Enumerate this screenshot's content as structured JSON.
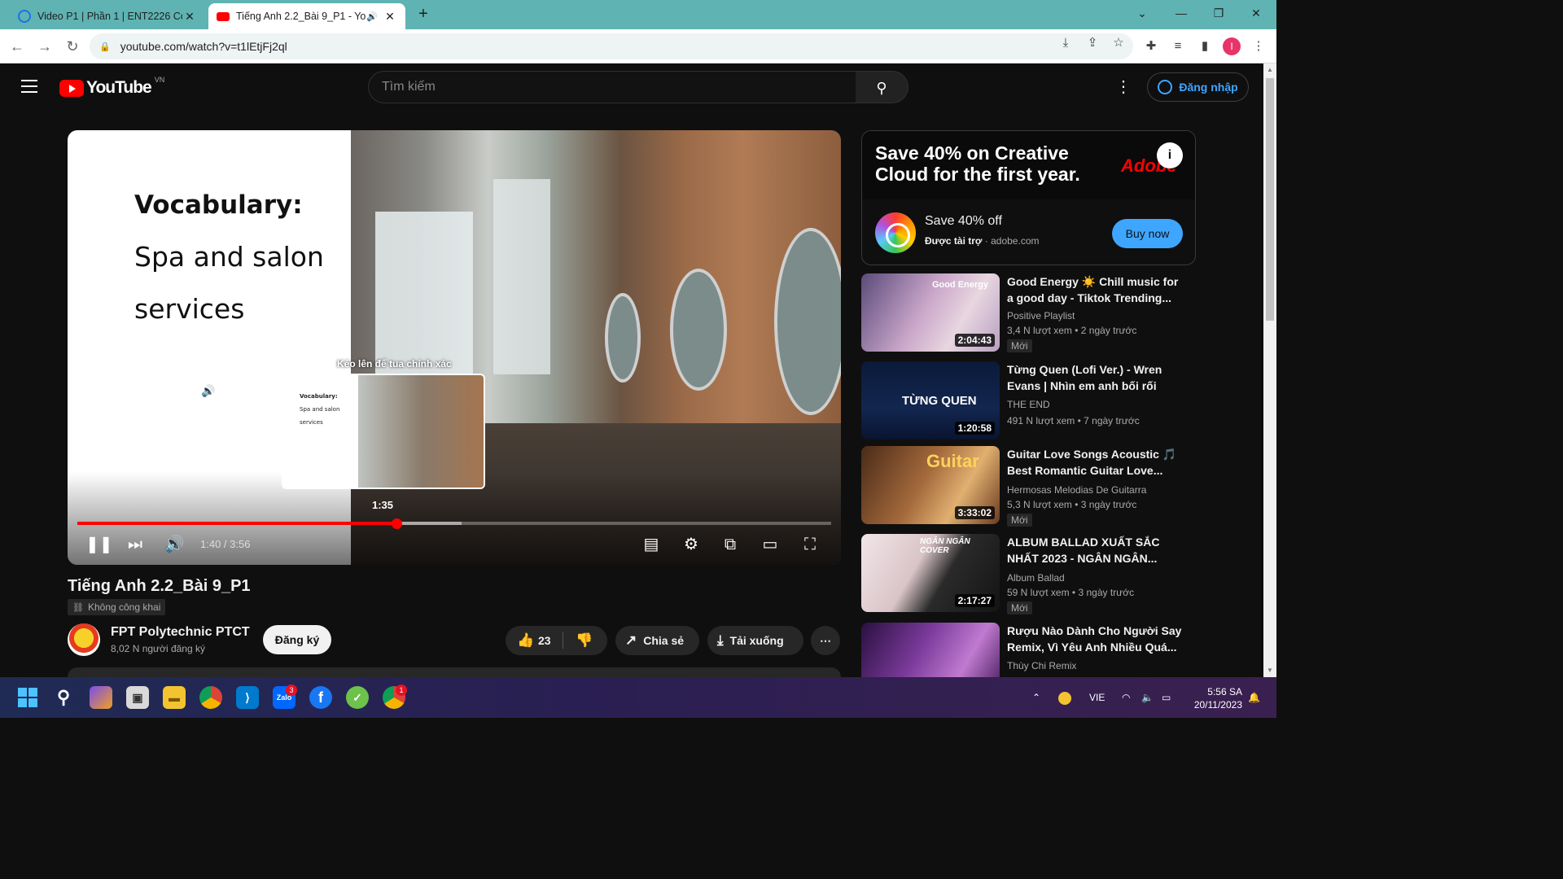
{
  "browser": {
    "tabs": [
      {
        "title": "Video P1 | Phần 1 | ENT2226 Co",
        "active": false
      },
      {
        "title": "Tiếng Anh 2.2_Bài 9_P1 - Yo",
        "active": true
      }
    ],
    "url": "youtube.com/watch?v=t1lEtjFj2ql",
    "profile_initial": "I"
  },
  "youtube": {
    "logo_text": "YouTube",
    "country_code": "VN",
    "search_placeholder": "Tìm kiếm",
    "sign_in_label": "Đăng nhập"
  },
  "player": {
    "slide": {
      "title": "Vocabulary:",
      "line1": "Spa and salon",
      "line2": "services",
      "preview_line1": "Vocabulary:",
      "preview_line2": "Spa and salon",
      "preview_line3": "services"
    },
    "seek_hint": "Kéo lên để tua chính xác",
    "preview_time": "1:35",
    "time_display": "1:40 / 3:56",
    "progress_played_fraction": 0.4237,
    "progress_loaded_fraction": 0.51
  },
  "video": {
    "title": "Tiếng Anh 2.2_Bài 9_P1",
    "visibility": "Không công khai",
    "channel_name": "FPT Polytechnic PTCT",
    "subscribers": "8,02 N người đăng ký",
    "subscribe_label": "Đăng ký",
    "likes": "23",
    "share_label": "Chia sẻ",
    "download_label": "Tải xuống",
    "more_label": "⋯"
  },
  "ad": {
    "headline": "Save 40% on Creative Cloud for the first year.",
    "brand": "Adobe",
    "title": "Save 40% off",
    "sponsored": "Được tài trợ",
    "domain": "adobe.com",
    "cta": "Buy now"
  },
  "recommendations": [
    {
      "title": "Good Energy ☀️ Chill music for a good day - Tiktok Trending...",
      "channel": "Positive Playlist",
      "views": "3,4 N lượt xem",
      "age": "2 ngày trước",
      "duration": "2:04:43",
      "badge": "Mới",
      "thumb_text": "Good Energy"
    },
    {
      "title": "Từng Quen (Lofi Ver.) - Wren Evans | Nhìn em anh bối rối an...",
      "channel": "THE END",
      "views": "491 N lượt xem",
      "age": "7 ngày trước",
      "duration": "1:20:58",
      "badge": "",
      "thumb_text": "TỪNG QUEN"
    },
    {
      "title": "Guitar Love Songs Acoustic 🎵 Best Romantic Guitar Love...",
      "channel": "Hermosas Melodias De Guitarra",
      "views": "5,3 N lượt xem",
      "age": "3 ngày trước",
      "duration": "3:33:02",
      "badge": "Mới",
      "thumb_text": "Guitar"
    },
    {
      "title": "ALBUM BALLAD XUẤT SẮC NHẤT 2023 - NGÂN NGÂN...",
      "channel": "Album Ballad",
      "views": "59 N lượt xem",
      "age": "3 ngày trước",
      "duration": "2:17:27",
      "badge": "Mới",
      "thumb_text": "NGÂN NGÂN COVER"
    },
    {
      "title": "Rượu Nào Dành Cho Người Say Remix, Vì Yêu Anh Nhiều Quá...",
      "channel": "Thùy Chi Remix",
      "views": "",
      "age": "",
      "duration": "",
      "badge": "",
      "thumb_text": ""
    }
  ],
  "taskbar": {
    "zalo_badge": "3",
    "chrome_badge": "1",
    "language": "VIE",
    "time": "5:56 SA",
    "date": "20/11/2023"
  },
  "colors": {
    "youtube_red": "#ff0000",
    "background": "#0f0f0f",
    "link_blue": "#3ea6ff",
    "tab_strip": "#5fb3b3"
  }
}
